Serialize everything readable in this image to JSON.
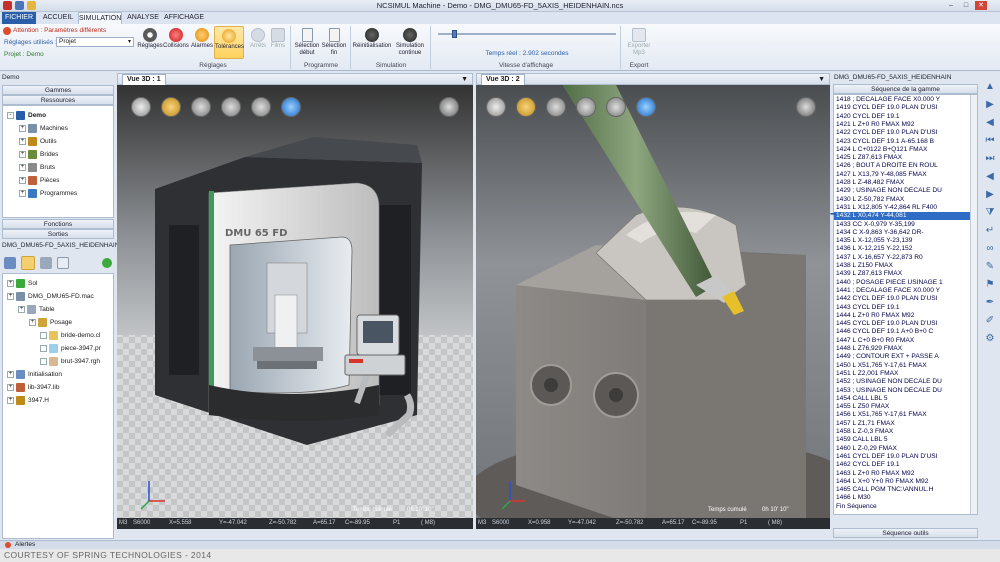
{
  "window": {
    "title": "NCSIMUL Machine - Demo - DMG_DMU65-FD_5AXIS_HEIDENHAIN.ncs",
    "controls": [
      "–",
      "□",
      "✕"
    ]
  },
  "tabs": [
    "FICHIER",
    "ACCUEIL",
    "SIMULATION",
    "ANALYSE",
    "AFFICHAGE"
  ],
  "ribbon": {
    "attention": "Attention : Paramètres différents",
    "settings_used_label": "Réglages utilisés :",
    "settings_used_value": "Projet",
    "project_label": "Projet : Demo",
    "buttons": {
      "reglages": "Réglages",
      "collisions": "Collisions",
      "alarmes": "Alarmes",
      "tolerances": "Tolérances",
      "arrets": "Arrêts",
      "films": "Films",
      "selection_debut": "Sélection début",
      "selection_fin": "Sélection fin",
      "reinitialisation": "Réinitialisation",
      "simulation_continue": "Simulation continue",
      "exporter": "Exporter Mp3"
    },
    "groups": {
      "reglages": "Réglages",
      "programme": "Programme",
      "simulation": "Simulation",
      "vitesse": "Vitesse d'affichage",
      "export": "Export"
    },
    "speed_text": "Temps réel : 2.902 secondes",
    "speed_level": 0.08
  },
  "left_panel": {
    "title": "Demo",
    "section_gammes": "Gammes",
    "section_ressources": "Ressources",
    "resources": [
      {
        "label": "Demo",
        "indent": 0,
        "exp": "-"
      },
      {
        "label": "Machines",
        "indent": 1,
        "exp": "+"
      },
      {
        "label": "Outils",
        "indent": 1,
        "exp": "+"
      },
      {
        "label": "Brides",
        "indent": 1,
        "exp": "+"
      },
      {
        "label": "Bruts",
        "indent": 1,
        "exp": "+"
      },
      {
        "label": "Pièces",
        "indent": 1,
        "exp": "+"
      },
      {
        "label": "Programmes",
        "indent": 1,
        "exp": "+"
      }
    ],
    "section_fonctions": "Fonctions",
    "section_sorties": "Sorties",
    "machine_title": "DMG_DMU65-FD_5AXIS_HEIDENHAIN",
    "machine_tree": [
      {
        "label": "Sol",
        "indent": 0
      },
      {
        "label": "DMG_DMU65-FD.mac",
        "indent": 0
      },
      {
        "label": "Table",
        "indent": 1
      },
      {
        "label": "Posage",
        "indent": 2
      },
      {
        "label": "bride-demo.cl",
        "indent": 3
      },
      {
        "label": "piece-3947.pr",
        "indent": 3
      },
      {
        "label": "brut-3947.rgh",
        "indent": 3
      },
      {
        "label": "Initialisation",
        "indent": 0
      },
      {
        "label": "lib-3947.lib",
        "indent": 0
      },
      {
        "label": "3947.H",
        "indent": 0
      }
    ]
  },
  "viewport1": {
    "tab": "Vue 3D : 1",
    "machine_label": "DMU 65 FD",
    "time_label": "Temps cumulé",
    "time_value": "0h 10' 10\"",
    "status": {
      "m3": "M3",
      "s": "S6000",
      "x": "X=5.558",
      "y": "Y=-47.042",
      "z": "Z=-50.782",
      "a": "A=65.17",
      "c": "C=-89.95",
      "p": "P1",
      "m": "( M8)"
    }
  },
  "viewport2": {
    "tab": "Vue 3D : 2",
    "time_label": "Temps cumulé",
    "time_value": "0h 10' 10\"",
    "status": {
      "m3": "M3",
      "s": "S6000",
      "x": "X=0.958",
      "y": "Y=-47.042",
      "z": "Z=-50.782",
      "a": "A=65.17",
      "c": "C=-89.95",
      "p": "P1",
      "m": "( M8)"
    }
  },
  "program": {
    "title": "DMG_DMU65-FD_5AXIS_HEIDENHAIN",
    "subtitle": "Séquence de la gamme",
    "footer_label": "Séquence outils",
    "lines": [
      "1418 ; DECALAGE FACE X0.000 Y",
      "1419 CYCL DEF 19.0 PLAN D'USI",
      "1420 CYCL DEF 19.1",
      "1421 L Z+0 R0 FMAX M92",
      "1422 CYCL DEF 19.0 PLAN D'USI",
      "1423 CYCL DEF 19.1  A-65.168  B",
      "1424 L C+0122  B+Q121 FMAX",
      "1425 L Z87,613 FMAX",
      "1426 ; BOUT A DROITE EN ROUL",
      "1427 L X13,79 Y-48,085 FMAX",
      "1428 L Z-48,482 FMAX",
      "1429 ; USINAGE NON DECALE DU",
      "1430 L Z-50,782 FMAX",
      "1431 L X12,805 Y-42,864 RL F400",
      "1432 L X0,474 Y-44,081",
      "1433 CC X-0,979 Y-35,199",
      "1434 C X-9,863 Y-36,642 DR-",
      "1435 L X-12,055 Y-23,139",
      "1436 L X-12,215 Y-22,152",
      "1437 L X-16,657 Y-22,873 R0",
      "1438 L Z150 FMAX",
      "1439 L Z87,613 FMAX",
      "1440 ; POSAGE PIECE USINAGE 1",
      "1441 ; DECALAGE FACE X0.000 Y",
      "1442 CYCL DEF 19.0 PLAN D'USI",
      "1443 CYCL DEF 19.1",
      "1444 L Z+0 R0 FMAX M92",
      "1445 CYCL DEF 19.0 PLAN D'USI",
      "1446 CYCL DEF 19.1  A+0  B+0  C",
      "1447 L C+0 B+0 R0 FMAX",
      "1448 L Z76,929 FMAX",
      "1449 ; CONTOUR EXT + PASSE A",
      "1450 L X51,765 Y-17,61 FMAX",
      "1451 L Z2,001 FMAX",
      "1452 ; USINAGE NON DECALE DU",
      "1453 ; USINAGE NON DECALE DU",
      "1454 CALL LBL 5",
      "1455 L Z50 FMAX",
      "1456 L X51,765 Y-17,61 FMAX",
      "1457 L Z1,71 FMAX",
      "1458 L Z-0,3 FMAX",
      "1459 CALL LBL 5",
      "1460 L Z-0,29 FMAX",
      "1461 CYCL DEF 19.0 PLAN D'USI",
      "1462 CYCL DEF 19.1",
      "1463 L Z+0 R0 FMAX M92",
      "1464 L  X+0  Y+0 R0 FMAX M92",
      "1465 CALL PGM TNC:\\ANNUL.H",
      "1466 L M30",
      "Fin Séquence"
    ],
    "selected_index": 14
  },
  "bottom": {
    "alerts": "Alertes",
    "footer": "COURTESY OF SPRING TECHNOLOGIES - 2014"
  },
  "colors": {
    "ribbon_accent": "#2b5ea8",
    "highlight": "#ffd25e",
    "selection": "#2f6cc6",
    "prog_text": "#000048"
  }
}
